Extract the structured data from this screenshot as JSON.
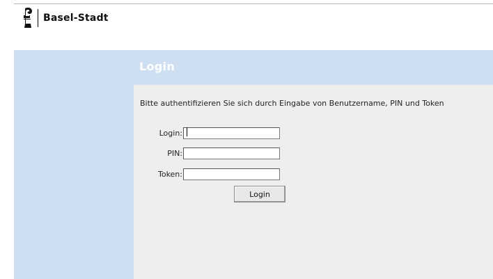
{
  "header": {
    "brand": "Basel-Stadt",
    "logo_icon": "basel-crozier-icon"
  },
  "panel": {
    "title": "Login",
    "instructions": "Bitte authentifizieren Sie sich durch Eingabe von Benutzername, PIN und Token"
  },
  "form": {
    "login_label": "Login:",
    "login_value": "",
    "pin_label": "PIN:",
    "pin_value": "",
    "token_label": "Token:",
    "token_value": "",
    "submit_label": "Login"
  },
  "colors": {
    "band": "#cddff0",
    "content_bg": "#eeeeee",
    "title_text": "#ffffff"
  }
}
